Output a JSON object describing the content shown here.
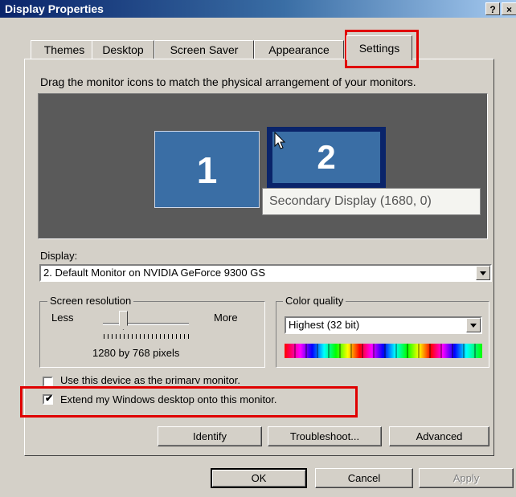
{
  "window": {
    "title": "Display Properties",
    "help": "?",
    "close": "×"
  },
  "tabs": [
    "Themes",
    "Desktop",
    "Screen Saver",
    "Appearance",
    "Settings"
  ],
  "active_tab": "Settings",
  "instruction": "Drag the monitor icons to match the physical arrangement of your monitors.",
  "monitors": {
    "one": "1",
    "two": "2",
    "tooltip": "Secondary Display (1680, 0)"
  },
  "display": {
    "label": "Display:",
    "value": "2. Default Monitor on NVIDIA GeForce 9300 GS"
  },
  "resolution": {
    "legend": "Screen resolution",
    "less": "Less",
    "more": "More",
    "value": "1280 by 768 pixels"
  },
  "color_quality": {
    "legend": "Color quality",
    "value": "Highest (32 bit)"
  },
  "checkboxes": {
    "primary": {
      "label": "Use this device as the primary monitor.",
      "checked": false
    },
    "extend": {
      "label": "Extend my Windows desktop onto this monitor.",
      "checked": true
    }
  },
  "actions": {
    "identify": "Identify",
    "troubleshoot": "Troubleshoot...",
    "advanced": "Advanced"
  },
  "footer": {
    "ok": "OK",
    "cancel": "Cancel",
    "apply": "Apply"
  },
  "colors": {
    "highlight": "#e00000",
    "monitor": "#3a6ea5",
    "selected": "#0a246a"
  }
}
